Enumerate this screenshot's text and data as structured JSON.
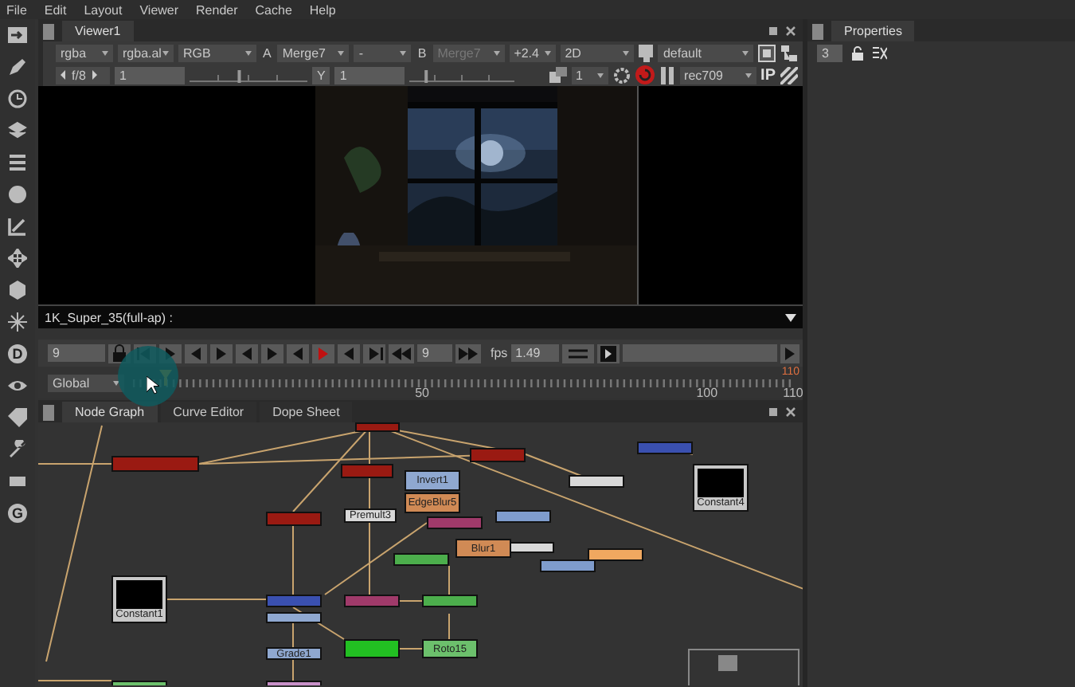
{
  "menu": [
    "File",
    "Edit",
    "Layout",
    "Viewer",
    "Render",
    "Cache",
    "Help"
  ],
  "toolbar_letters": [
    "D",
    "G"
  ],
  "viewer": {
    "tab": "Viewer1",
    "channels": "rgba",
    "alpha": "rgba.al",
    "display": "RGB",
    "input_a_label": "A",
    "input_a": "Merge7",
    "operation": "-",
    "input_b_label": "B",
    "input_b": "Merge7",
    "input_b_disabled": true,
    "gamma": "+2.4",
    "view_mode": "2D",
    "lut": "default",
    "fstop": "f/8",
    "gain": "1",
    "gain_slider": {
      "level": 0.42
    },
    "gamma_slider": {
      "level": 0.15
    },
    "gamma_label": "Y",
    "gamma_value": "1",
    "proxy": "1",
    "colorspace": "rec709",
    "ip_button": "IP",
    "format": "1K_Super_35(full-ap) :"
  },
  "playback": {
    "frame": "9",
    "increment": "9",
    "fps_label": "fps",
    "fps": "1.49"
  },
  "timeline": {
    "range": "Global",
    "ticks": [
      "50",
      "100",
      "110"
    ],
    "current": "110"
  },
  "graph_tabs": [
    {
      "label": "Node Graph",
      "selected": true
    },
    {
      "label": "Curve Editor",
      "selected": false
    },
    {
      "label": "Dope Sheet",
      "selected": false
    }
  ],
  "nodes": [
    {
      "kind": "node",
      "color": "#9a1a12"
    },
    {
      "kind": "node",
      "color": "#9a1a12"
    },
    {
      "kind": "node",
      "color": "#9a1a12"
    },
    {
      "kind": "node",
      "color": "#9a1a12"
    },
    {
      "kind": "node",
      "color": "#9a1a12"
    },
    {
      "kind": "node",
      "color": "#8fa8d0",
      "label": "Invert1"
    },
    {
      "kind": "node",
      "color": "#d08a55",
      "label": "EdgeBlur5"
    },
    {
      "kind": "node",
      "color": "#d8d8d8",
      "label": "Premult3"
    },
    {
      "kind": "node",
      "color": "#a03a6a"
    },
    {
      "kind": "node",
      "color": "#7f9ccc"
    },
    {
      "kind": "node",
      "color": "#d8d8d8"
    },
    {
      "kind": "node",
      "color": "#3a50b0"
    },
    {
      "kind": "constant",
      "color": "#c8c8c8",
      "label": "Constant4"
    },
    {
      "kind": "node",
      "color": "#d08a55",
      "label": "Blur1"
    },
    {
      "kind": "node",
      "color": "#d8d8d8"
    },
    {
      "kind": "node",
      "color": "#7f9ccc"
    },
    {
      "kind": "node",
      "color": "#f0a860"
    },
    {
      "kind": "node",
      "color": "#4cae4c"
    },
    {
      "kind": "constant",
      "color": "#c8c8c8",
      "label": "Constant1"
    },
    {
      "kind": "node",
      "color": "#3a50b0"
    },
    {
      "kind": "node",
      "color": "#8fa8d0"
    },
    {
      "kind": "node",
      "color": "#a03a6a"
    },
    {
      "kind": "node",
      "color": "#4cae4c"
    },
    {
      "kind": "node",
      "color": "#22c022"
    },
    {
      "kind": "node",
      "color": "#6cc06c",
      "label": "Roto15"
    },
    {
      "kind": "node",
      "color": "#8fa8d0",
      "label": "Grade1"
    },
    {
      "kind": "node",
      "color": "#c890c8"
    },
    {
      "kind": "node",
      "color": "#6cc06c"
    }
  ],
  "properties": {
    "tab": "Properties",
    "field": "3"
  }
}
